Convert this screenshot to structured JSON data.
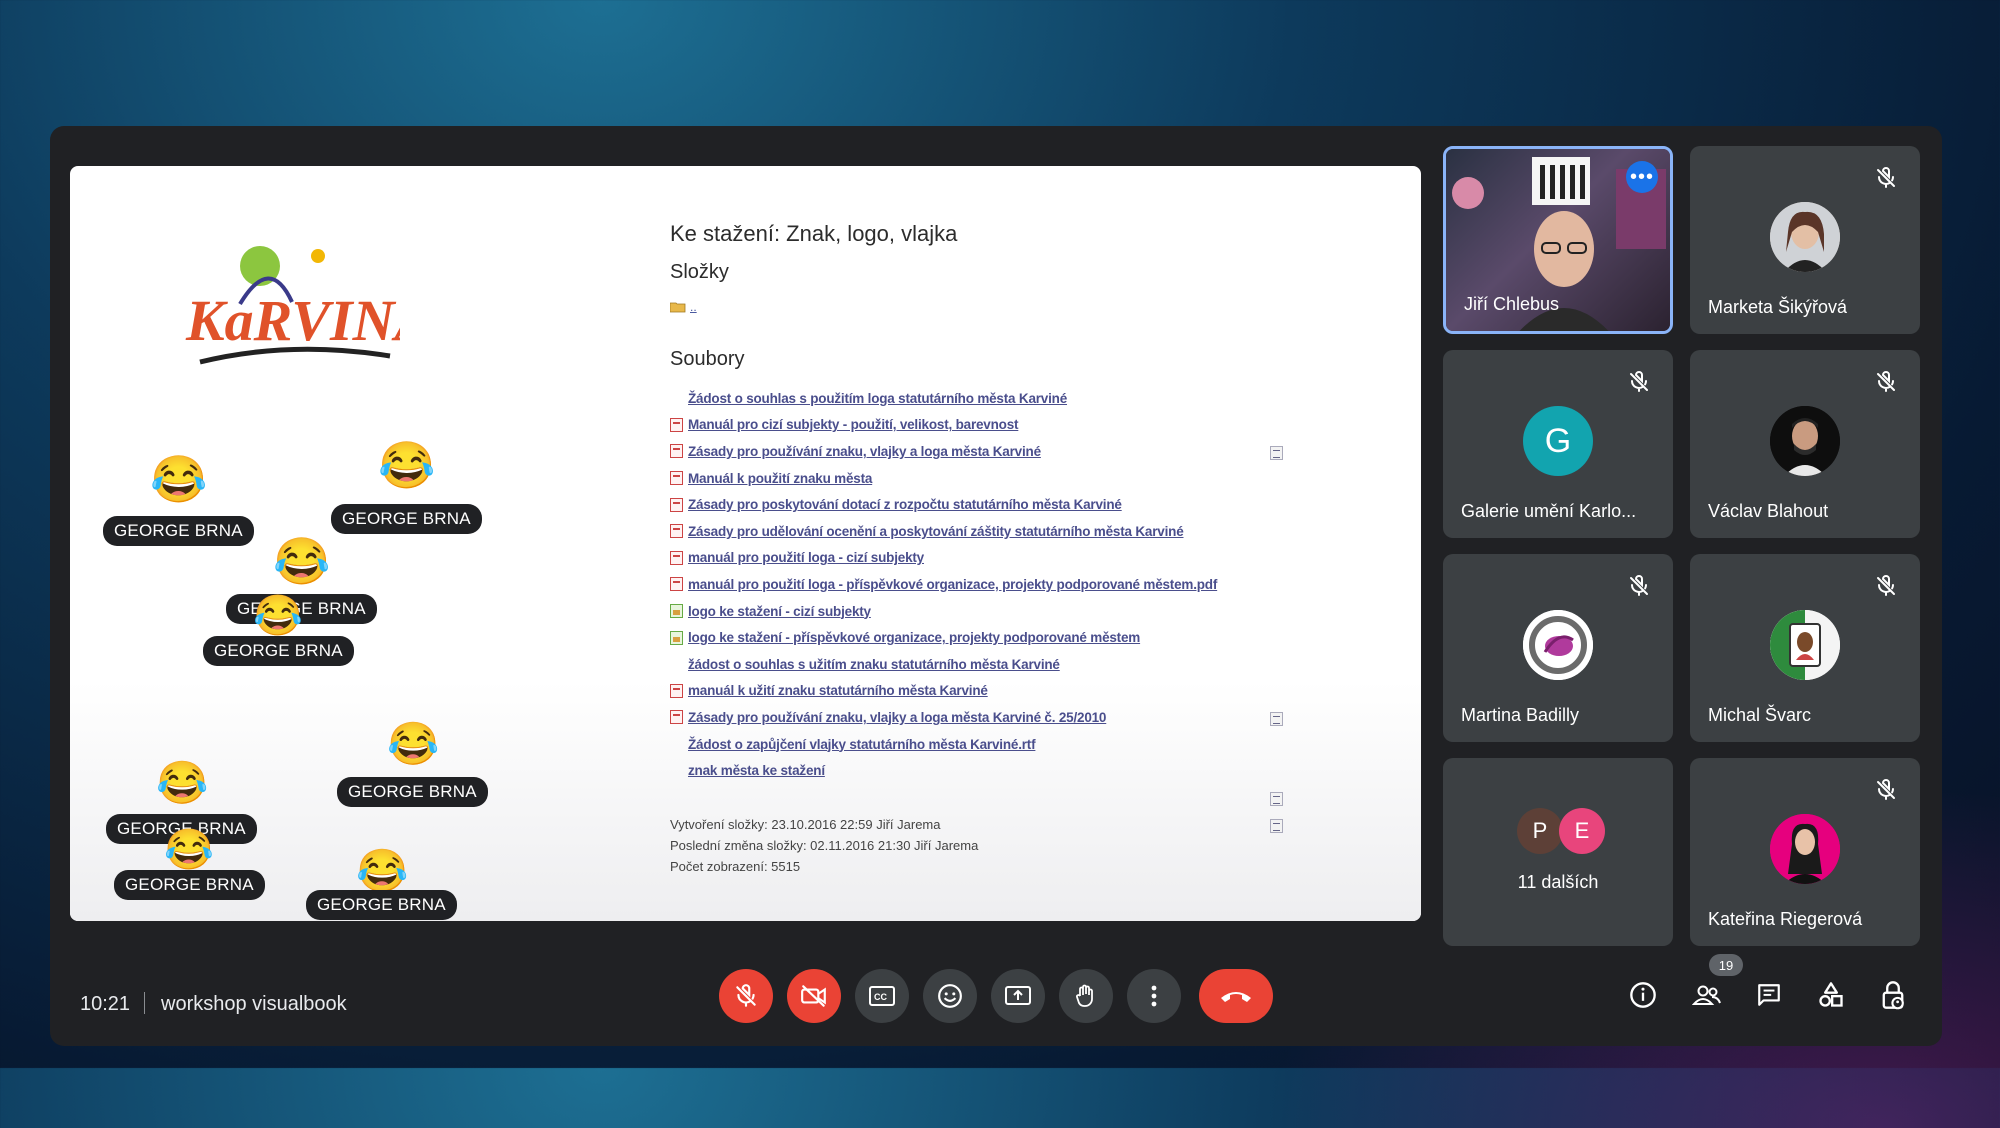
{
  "presentation": {
    "doc_title": "Ke stažení: Znak, logo, vlajka",
    "folders_heading": "Složky",
    "parent_folder": "..",
    "files_heading": "Soubory",
    "files": [
      {
        "name": "Žádost o souhlas s použitím loga statutárního města Karviné",
        "type": "doc"
      },
      {
        "name": "Manuál pro cizí subjekty - použití, velikost, barevnost",
        "type": "pdf"
      },
      {
        "name": "Zásady pro používání znaku, vlajky a loga města Karviné",
        "type": "pdf"
      },
      {
        "name": "Manuál k použití znaku města",
        "type": "pdf"
      },
      {
        "name": "Zásady pro poskytování dotací z rozpočtu statutárního města Karviné",
        "type": "pdf"
      },
      {
        "name": "Zásady pro udělování ocenění a poskytování záštity statutárního města Karviné",
        "type": "pdf"
      },
      {
        "name": "manuál pro použití loga - cizí subjekty",
        "type": "pdf"
      },
      {
        "name": "manuál pro použití loga - příspěvkové organizace, projekty podporované městem.pdf",
        "type": "pdf"
      },
      {
        "name": "logo ke stažení - cizí subjekty",
        "type": "img"
      },
      {
        "name": "logo ke stažení - příspěvkové organizace, projekty podporované městem",
        "type": "img"
      },
      {
        "name": "žádost o souhlas s užitím znaku statutárního města Karviné",
        "type": "doc"
      },
      {
        "name": "manuál k užití znaku statutárního města Karviné",
        "type": "pdf"
      },
      {
        "name": "Zásady pro používání znaku, vlajky a loga města Karviné č. 25/2010",
        "type": "pdf"
      },
      {
        "name": "Žádost o zapůjčení vlajky statutárního města Karviné.rtf",
        "type": "doc"
      },
      {
        "name": "znak města ke stažení",
        "type": "doc"
      }
    ],
    "meta": {
      "created": "Vytvoření složky: 23.10.2016 22:59 Jiří Jarema",
      "modified": "Poslední změna složky: 02.11.2016 21:30 Jiří Jarema",
      "views": "Počet zobrazení: 5515"
    },
    "logo_text": "KaRVINÁ"
  },
  "reactions": {
    "emoji": "😂",
    "name": "GEORGE BRNA"
  },
  "participants": [
    {
      "name": "Jiří Chlebus",
      "type": "video",
      "active": true
    },
    {
      "name": "Marketa Šikýřová",
      "type": "photo",
      "muted": true
    },
    {
      "name": "Galerie umění Karlo...",
      "type": "letter",
      "letter": "G",
      "color": "#12a4af",
      "muted": true
    },
    {
      "name": "Václav Blahout",
      "type": "photo",
      "muted": true
    },
    {
      "name": "Martina Badilly",
      "type": "photo",
      "muted": true
    },
    {
      "name": "Michal Švarc",
      "type": "photo",
      "muted": true
    },
    {
      "name": "11 dalších",
      "type": "group",
      "letters": [
        "P",
        "E"
      ],
      "colors": [
        "#5d4037",
        "#e8457c"
      ]
    },
    {
      "name": "Kateřina Riegerová",
      "type": "photo",
      "muted": true
    }
  ],
  "bottom_bar": {
    "time": "10:21",
    "meeting_name": "workshop visualbook",
    "participant_count": "19"
  },
  "colors": {
    "accent": "#8ab4f8",
    "danger": "#ea4335",
    "panel": "#3c4043",
    "window": "#202124"
  }
}
